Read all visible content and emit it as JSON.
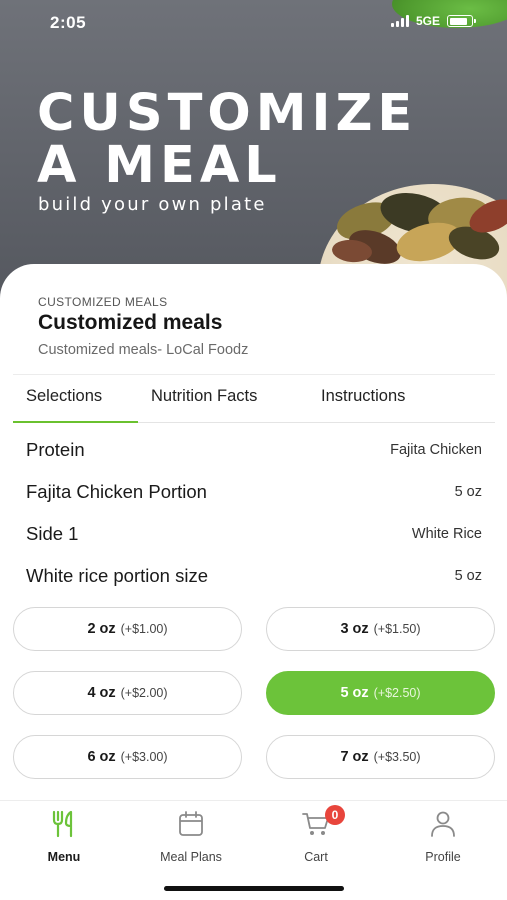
{
  "status_bar": {
    "time": "2:05",
    "network": "5GE",
    "battery_fraction": 0.85
  },
  "hero": {
    "title_line1": "CUSTOMIZE",
    "title_line2": "A MEAL",
    "subtitle": "build your own plate"
  },
  "product": {
    "category": "CUSTOMIZED MEALS",
    "title": "Customized meals",
    "subtitle": "Customized meals- LoCal Foodz"
  },
  "tabs": [
    {
      "label": "Selections",
      "active": true
    },
    {
      "label": "Nutrition Facts",
      "active": false
    },
    {
      "label": "Instructions",
      "active": false
    }
  ],
  "selections": [
    {
      "label": "Protein",
      "value": "Fajita Chicken"
    },
    {
      "label": "Fajita Chicken Portion",
      "value": "5 oz"
    },
    {
      "label": "Side 1",
      "value": "White Rice"
    },
    {
      "label": "White rice portion size",
      "value": "5 oz"
    }
  ],
  "portion_options": [
    {
      "size": "2 oz",
      "price": "(+$1.00)",
      "selected": false
    },
    {
      "size": "3 oz",
      "price": "(+$1.50)",
      "selected": false
    },
    {
      "size": "4 oz",
      "price": "(+$2.00)",
      "selected": false
    },
    {
      "size": "5 oz",
      "price": "(+$2.50)",
      "selected": true
    },
    {
      "size": "6 oz",
      "price": "(+$3.00)",
      "selected": false
    },
    {
      "size": "7 oz",
      "price": "(+$3.50)",
      "selected": false
    }
  ],
  "bottom_nav": [
    {
      "label": "Menu",
      "icon": "fork-knife-icon",
      "active": true
    },
    {
      "label": "Meal Plans",
      "icon": "calendar-icon",
      "active": false
    },
    {
      "label": "Cart",
      "icon": "cart-icon",
      "active": false,
      "badge": "0"
    },
    {
      "label": "Profile",
      "icon": "person-icon",
      "active": false
    }
  ],
  "colors": {
    "accent": "#6cc33a",
    "badge": "#e8453c",
    "hero_bg": "#63666d"
  }
}
